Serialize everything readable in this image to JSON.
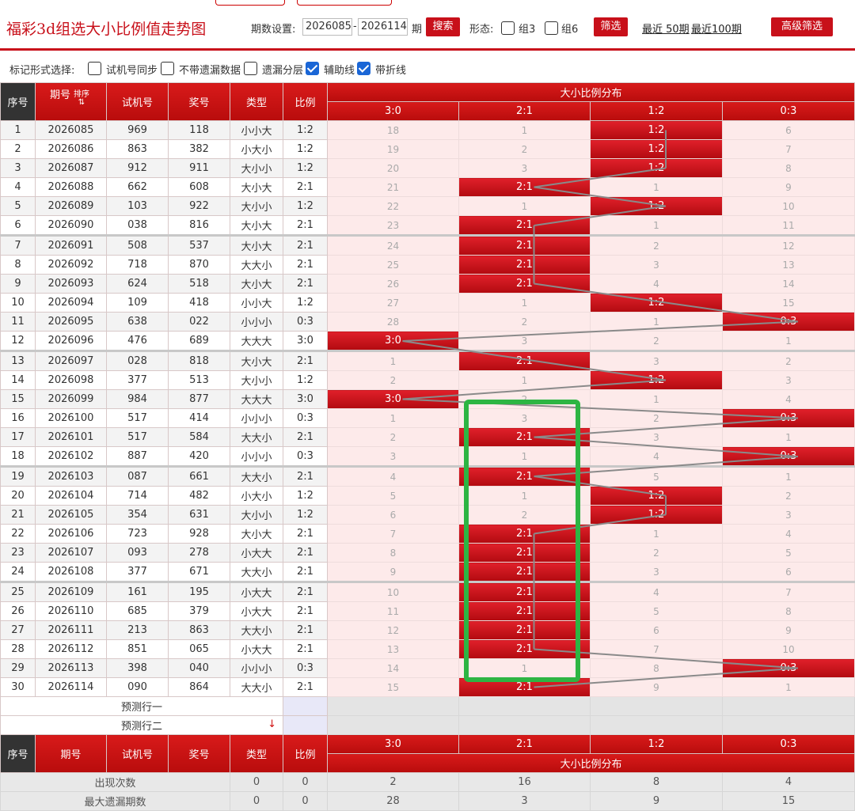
{
  "header": {
    "title": "福彩3d组选大小比例值走势图",
    "period_label": "期数设置:",
    "period_from": "2026085",
    "dash": "-",
    "period_to": "2026114",
    "period_unit": "期",
    "search_btn": "搜索",
    "form_label": "形态:",
    "group3_label": "组3",
    "group6_label": "组6",
    "filter_btn": "筛选",
    "recent50": "最近 50期",
    "recent100": "最近100期",
    "adv_btn": "高级筛选"
  },
  "options": {
    "label": "标记形式选择:",
    "items": [
      {
        "label": "试机号同步",
        "checked": false
      },
      {
        "label": "不带遗漏数据",
        "checked": false
      },
      {
        "label": "遗漏分层",
        "checked": false
      },
      {
        "label": "辅助线",
        "checked": true
      },
      {
        "label": "带折线",
        "checked": true
      }
    ]
  },
  "table": {
    "headers": {
      "seq": "序号",
      "issue": "期号",
      "sort": "排序",
      "trial": "试机号",
      "award": "奖号",
      "type": "类型",
      "ratio": "比例",
      "dist": "大小比例分布"
    },
    "dist_cols": [
      "3:0",
      "2:1",
      "1:2",
      "0:3"
    ],
    "rows": [
      {
        "seq": "1",
        "issue": "2026085",
        "trial": "969",
        "award": "118",
        "type": "小小大",
        "ratio": "1:2",
        "dist": [
          "18",
          "1",
          "1:2",
          "6"
        ],
        "hit": 2
      },
      {
        "seq": "2",
        "issue": "2026086",
        "trial": "863",
        "award": "382",
        "type": "小大小",
        "ratio": "1:2",
        "dist": [
          "19",
          "2",
          "1:2",
          "7"
        ],
        "hit": 2
      },
      {
        "seq": "3",
        "issue": "2026087",
        "trial": "912",
        "award": "911",
        "type": "大小小",
        "ratio": "1:2",
        "dist": [
          "20",
          "3",
          "1:2",
          "8"
        ],
        "hit": 2
      },
      {
        "seq": "4",
        "issue": "2026088",
        "trial": "662",
        "award": "608",
        "type": "大小大",
        "ratio": "2:1",
        "dist": [
          "21",
          "2:1",
          "1",
          "9"
        ],
        "hit": 1
      },
      {
        "seq": "5",
        "issue": "2026089",
        "trial": "103",
        "award": "922",
        "type": "大小小",
        "ratio": "1:2",
        "dist": [
          "22",
          "1",
          "1:2",
          "10"
        ],
        "hit": 2
      },
      {
        "seq": "6",
        "issue": "2026090",
        "trial": "038",
        "award": "816",
        "type": "大小大",
        "ratio": "2:1",
        "dist": [
          "23",
          "2:1",
          "1",
          "11"
        ],
        "hit": 1
      },
      {
        "seq": "7",
        "issue": "2026091",
        "trial": "508",
        "award": "537",
        "type": "大小大",
        "ratio": "2:1",
        "dist": [
          "24",
          "2:1",
          "2",
          "12"
        ],
        "hit": 1
      },
      {
        "seq": "8",
        "issue": "2026092",
        "trial": "718",
        "award": "870",
        "type": "大大小",
        "ratio": "2:1",
        "dist": [
          "25",
          "2:1",
          "3",
          "13"
        ],
        "hit": 1
      },
      {
        "seq": "9",
        "issue": "2026093",
        "trial": "624",
        "award": "518",
        "type": "大小大",
        "ratio": "2:1",
        "dist": [
          "26",
          "2:1",
          "4",
          "14"
        ],
        "hit": 1
      },
      {
        "seq": "10",
        "issue": "2026094",
        "trial": "109",
        "award": "418",
        "type": "小小大",
        "ratio": "1:2",
        "dist": [
          "27",
          "1",
          "1:2",
          "15"
        ],
        "hit": 2
      },
      {
        "seq": "11",
        "issue": "2026095",
        "trial": "638",
        "award": "022",
        "type": "小小小",
        "ratio": "0:3",
        "dist": [
          "28",
          "2",
          "1",
          "0:3"
        ],
        "hit": 3
      },
      {
        "seq": "12",
        "issue": "2026096",
        "trial": "476",
        "award": "689",
        "type": "大大大",
        "ratio": "3:0",
        "dist": [
          "3:0",
          "3",
          "2",
          "1"
        ],
        "hit": 0
      },
      {
        "seq": "13",
        "issue": "2026097",
        "trial": "028",
        "award": "818",
        "type": "大小大",
        "ratio": "2:1",
        "dist": [
          "1",
          "2:1",
          "3",
          "2"
        ],
        "hit": 1
      },
      {
        "seq": "14",
        "issue": "2026098",
        "trial": "377",
        "award": "513",
        "type": "大小小",
        "ratio": "1:2",
        "dist": [
          "2",
          "1",
          "1:2",
          "3"
        ],
        "hit": 2
      },
      {
        "seq": "15",
        "issue": "2026099",
        "trial": "984",
        "award": "877",
        "type": "大大大",
        "ratio": "3:0",
        "dist": [
          "3:0",
          "2",
          "1",
          "4"
        ],
        "hit": 0
      },
      {
        "seq": "16",
        "issue": "2026100",
        "trial": "517",
        "award": "414",
        "type": "小小小",
        "ratio": "0:3",
        "dist": [
          "1",
          "3",
          "2",
          "0:3"
        ],
        "hit": 3
      },
      {
        "seq": "17",
        "issue": "2026101",
        "trial": "517",
        "award": "584",
        "type": "大大小",
        "ratio": "2:1",
        "dist": [
          "2",
          "2:1",
          "3",
          "1"
        ],
        "hit": 1
      },
      {
        "seq": "18",
        "issue": "2026102",
        "trial": "887",
        "award": "420",
        "type": "小小小",
        "ratio": "0:3",
        "dist": [
          "3",
          "1",
          "4",
          "0:3"
        ],
        "hit": 3
      },
      {
        "seq": "19",
        "issue": "2026103",
        "trial": "087",
        "award": "661",
        "type": "大大小",
        "ratio": "2:1",
        "dist": [
          "4",
          "2:1",
          "5",
          "1"
        ],
        "hit": 1
      },
      {
        "seq": "20",
        "issue": "2026104",
        "trial": "714",
        "award": "482",
        "type": "小大小",
        "ratio": "1:2",
        "dist": [
          "5",
          "1",
          "1:2",
          "2"
        ],
        "hit": 2
      },
      {
        "seq": "21",
        "issue": "2026105",
        "trial": "354",
        "award": "631",
        "type": "大小小",
        "ratio": "1:2",
        "dist": [
          "6",
          "2",
          "1:2",
          "3"
        ],
        "hit": 2
      },
      {
        "seq": "22",
        "issue": "2026106",
        "trial": "723",
        "award": "928",
        "type": "大小大",
        "ratio": "2:1",
        "dist": [
          "7",
          "2:1",
          "1",
          "4"
        ],
        "hit": 1
      },
      {
        "seq": "23",
        "issue": "2026107",
        "trial": "093",
        "award": "278",
        "type": "小大大",
        "ratio": "2:1",
        "dist": [
          "8",
          "2:1",
          "2",
          "5"
        ],
        "hit": 1
      },
      {
        "seq": "24",
        "issue": "2026108",
        "trial": "377",
        "award": "671",
        "type": "大大小",
        "ratio": "2:1",
        "dist": [
          "9",
          "2:1",
          "3",
          "6"
        ],
        "hit": 1
      },
      {
        "seq": "25",
        "issue": "2026109",
        "trial": "161",
        "award": "195",
        "type": "小大大",
        "ratio": "2:1",
        "dist": [
          "10",
          "2:1",
          "4",
          "7"
        ],
        "hit": 1
      },
      {
        "seq": "26",
        "issue": "2026110",
        "trial": "685",
        "award": "379",
        "type": "小大大",
        "ratio": "2:1",
        "dist": [
          "11",
          "2:1",
          "5",
          "8"
        ],
        "hit": 1
      },
      {
        "seq": "27",
        "issue": "2026111",
        "trial": "213",
        "award": "863",
        "type": "大大小",
        "ratio": "2:1",
        "dist": [
          "12",
          "2:1",
          "6",
          "9"
        ],
        "hit": 1
      },
      {
        "seq": "28",
        "issue": "2026112",
        "trial": "851",
        "award": "065",
        "type": "小大大",
        "ratio": "2:1",
        "dist": [
          "13",
          "2:1",
          "7",
          "10"
        ],
        "hit": 1
      },
      {
        "seq": "29",
        "issue": "2026113",
        "trial": "398",
        "award": "040",
        "type": "小小小",
        "ratio": "0:3",
        "dist": [
          "14",
          "1",
          "8",
          "0:3"
        ],
        "hit": 3
      },
      {
        "seq": "30",
        "issue": "2026114",
        "trial": "090",
        "award": "864",
        "type": "大大小",
        "ratio": "2:1",
        "dist": [
          "15",
          "2:1",
          "9",
          "1"
        ],
        "hit": 1
      }
    ],
    "predict1": "预测行一",
    "predict2": "预测行二",
    "predict_arrow": "↓"
  },
  "footer": {
    "headers": {
      "seq": "序号",
      "issue": "期号",
      "trial": "试机号",
      "award": "奖号",
      "type": "类型",
      "ratio": "比例",
      "dist": "大小比例分布"
    },
    "dist_cols": [
      "3:0",
      "2:1",
      "1:2",
      "0:3"
    ],
    "stats": [
      {
        "label": "出现次数",
        "type": "0",
        "ratio": "0",
        "vals": [
          "2",
          "16",
          "8",
          "4"
        ]
      },
      {
        "label": "最大遗漏期数",
        "type": "0",
        "ratio": "0",
        "vals": [
          "28",
          "3",
          "9",
          "15"
        ]
      }
    ]
  },
  "colors": {
    "brand_red": "#c8101a",
    "hit_red": "#d4161f",
    "highlight_green": "#2db543",
    "trend_line": "#8a8a8a"
  }
}
